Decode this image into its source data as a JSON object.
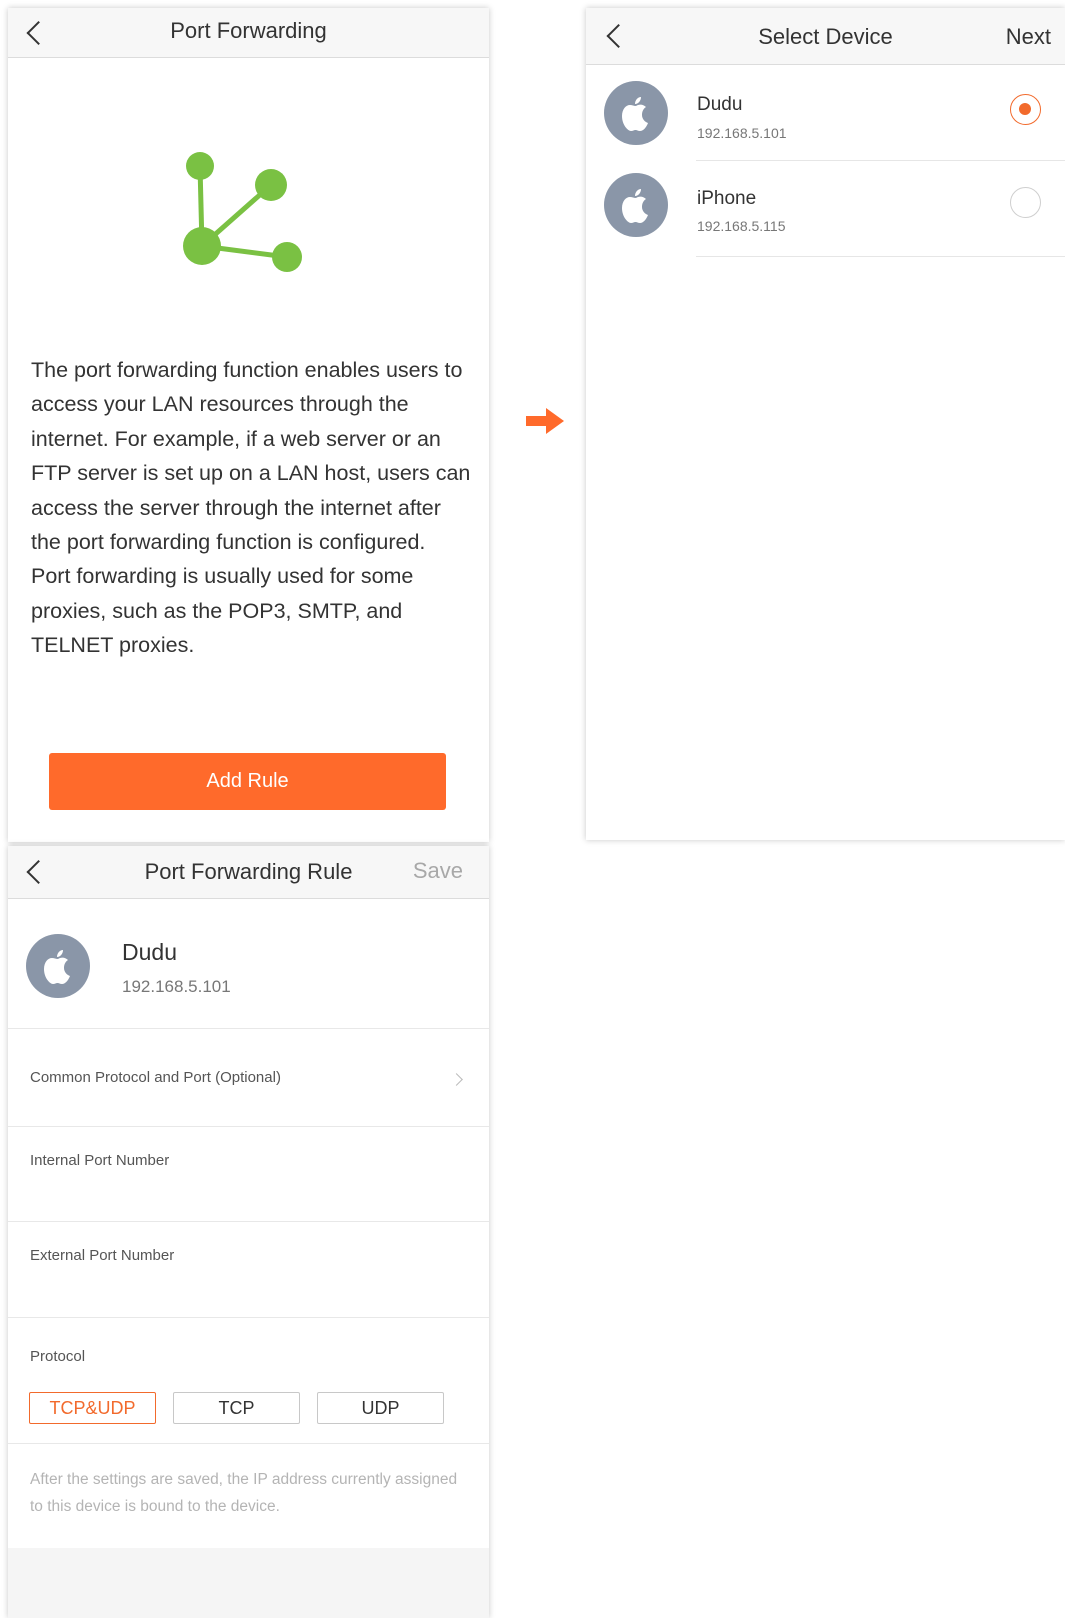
{
  "colors": {
    "accent": "#ff6a2b",
    "icon_green": "#7ac143",
    "avatar_gray": "#8a96a8"
  },
  "arrow_icon": "right-arrow",
  "port_forwarding": {
    "title": "Port Forwarding",
    "icon": "network-branch-icon",
    "description_lines": [
      "The port forwarding function enables users to access your LAN resources through the internet. For example, if a web server or an FTP server is set up on a LAN host, users can access the server through the internet after the port forwarding function is configured.",
      "Port forwarding is usually used for some proxies, such as the POP3, SMTP, and TELNET proxies."
    ],
    "add_rule_label": "Add Rule"
  },
  "select_device": {
    "title": "Select Device",
    "next_label": "Next",
    "devices": [
      {
        "name": "Dudu",
        "ip": "192.168.5.101",
        "selected": true,
        "icon": "apple-icon"
      },
      {
        "name": "iPhone",
        "ip": "192.168.5.115",
        "selected": false,
        "icon": "apple-icon"
      }
    ]
  },
  "rule": {
    "title": "Port Forwarding Rule",
    "save_label": "Save",
    "device": {
      "name": "Dudu",
      "ip": "192.168.5.101",
      "icon": "apple-icon"
    },
    "common_protocol_label": "Common Protocol and Port (Optional)",
    "internal_port_label": "Internal Port Number",
    "internal_port_value": "",
    "external_port_label": "External Port Number",
    "external_port_value": "",
    "protocol_label": "Protocol",
    "protocols": [
      "TCP&UDP",
      "TCP",
      "UDP"
    ],
    "selected_protocol": "TCP&UDP",
    "note": "After the settings are saved, the IP address currently assigned to this device is bound to the device."
  }
}
